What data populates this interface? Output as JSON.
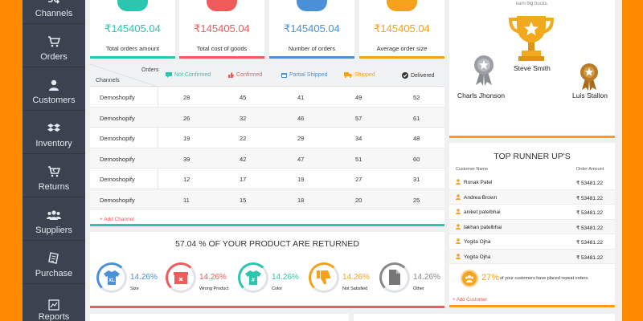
{
  "sidebar": {
    "items": [
      {
        "label": "Channels",
        "icon": "shuffle-icon"
      },
      {
        "label": "Orders",
        "icon": "cart-icon"
      },
      {
        "label": "Customers",
        "icon": "user-icon"
      },
      {
        "label": "Inventory",
        "icon": "dropbox-icon"
      },
      {
        "label": "Returns",
        "icon": "return-cart-icon"
      },
      {
        "label": "Suppliers",
        "icon": "group-icon"
      },
      {
        "label": "Purchase",
        "icon": "receipt-icon"
      },
      {
        "label": "Reports",
        "icon": "chart-icon"
      }
    ]
  },
  "stats": [
    {
      "value": "₹145405.04",
      "label": "Total orders amount",
      "color": "#2cc5ad"
    },
    {
      "value": "₹145405.04",
      "label": "Total cost of goods",
      "color": "#ef5b5b"
    },
    {
      "value": "₹145405.04",
      "label": "Number of orders",
      "color": "#4a90d9"
    },
    {
      "value": "₹145405.04",
      "label": "Average order size",
      "color": "#f5a11c"
    }
  ],
  "table": {
    "corner_top": "Orders",
    "corner_bottom": "Channels",
    "columns": [
      {
        "label": "Not Confirmed",
        "color": "#2cc5ad"
      },
      {
        "label": "Confirmed",
        "color": "#ef5b5b"
      },
      {
        "label": "Partial Shipped",
        "color": "#4a90d9"
      },
      {
        "label": "Shipped",
        "color": "#f5a11c"
      },
      {
        "label": "Delivered",
        "color": "#333333"
      }
    ],
    "rows": [
      {
        "channel": "Demoshopify",
        "values": [
          "28",
          "45",
          "41",
          "49",
          "52"
        ]
      },
      {
        "channel": "Demoshopify",
        "values": [
          "26",
          "32",
          "46",
          "57",
          "61"
        ]
      },
      {
        "channel": "Demoshopify",
        "values": [
          "19",
          "22",
          "29",
          "34",
          "48"
        ]
      },
      {
        "channel": "Demoshopify",
        "values": [
          "39",
          "42",
          "47",
          "51",
          "60"
        ]
      },
      {
        "channel": "Demoshopify",
        "values": [
          "12",
          "17",
          "19",
          "27",
          "31"
        ]
      },
      {
        "channel": "Demoshopify",
        "values": [
          "11",
          "15",
          "18",
          "20",
          "25"
        ]
      }
    ],
    "add_label": "+ Add Channel"
  },
  "returned": {
    "title": "57.04 % OF YOUR PRODUCT ARE RETURNED",
    "items": [
      {
        "pct": "14.26%",
        "label": "Size",
        "color": "#4a90d9",
        "icon": "tshirt-xl-icon"
      },
      {
        "pct": "14.26%",
        "label": "Wrong Product",
        "color": "#ef5b5b",
        "icon": "box-icon"
      },
      {
        "pct": "14.26%",
        "label": "Color",
        "color": "#2cc5ad",
        "icon": "tshirt-hash-icon"
      },
      {
        "pct": "14.26%",
        "label": "Not Satisfied",
        "color": "#f5a11c",
        "icon": "thumbs-down-icon"
      },
      {
        "pct": "14.26%",
        "label": "Other",
        "color": "#888888",
        "icon": "document-icon"
      }
    ]
  },
  "trophy": {
    "top_text": "earn big bucks.",
    "first": "Steve Smith",
    "second": "Charls Jhonson",
    "third": "Luis Stallon"
  },
  "runners": {
    "title": "TOP RUNNER UP'S",
    "head_name": "Customer Name",
    "head_amount": "Order Amount",
    "rows": [
      {
        "name": "Ronak Patel",
        "amount": "₹ 53481.22"
      },
      {
        "name": "Andrea Brown",
        "amount": "₹ 53481.22"
      },
      {
        "name": "aniket patelbhai",
        "amount": "₹ 53481.22"
      },
      {
        "name": "lakhan patelbhai",
        "amount": "₹ 53481.22"
      },
      {
        "name": "Yogita Ojha",
        "amount": "₹ 53481.22"
      },
      {
        "name": "Yogita Ojha",
        "amount": "₹ 53481.22"
      }
    ],
    "repeat_pct": "27%",
    "repeat_text": "of your customers have placed repeat orders.",
    "add_label": "+ Add Customer"
  }
}
